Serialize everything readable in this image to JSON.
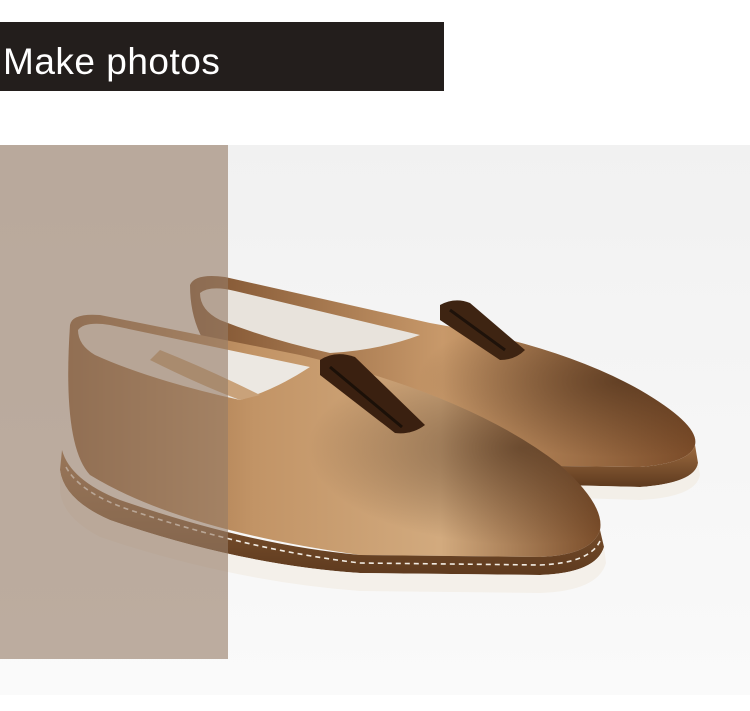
{
  "title": {
    "text": "Make photos"
  },
  "image": {
    "subject": "pair-of-tan-leather-slip-on-loafers"
  },
  "colors": {
    "title_background": "#231e1c",
    "title_text": "#ffffff",
    "overlay": "#967c68",
    "leather": "#b98a5c",
    "sole": "#f4f0ea"
  }
}
